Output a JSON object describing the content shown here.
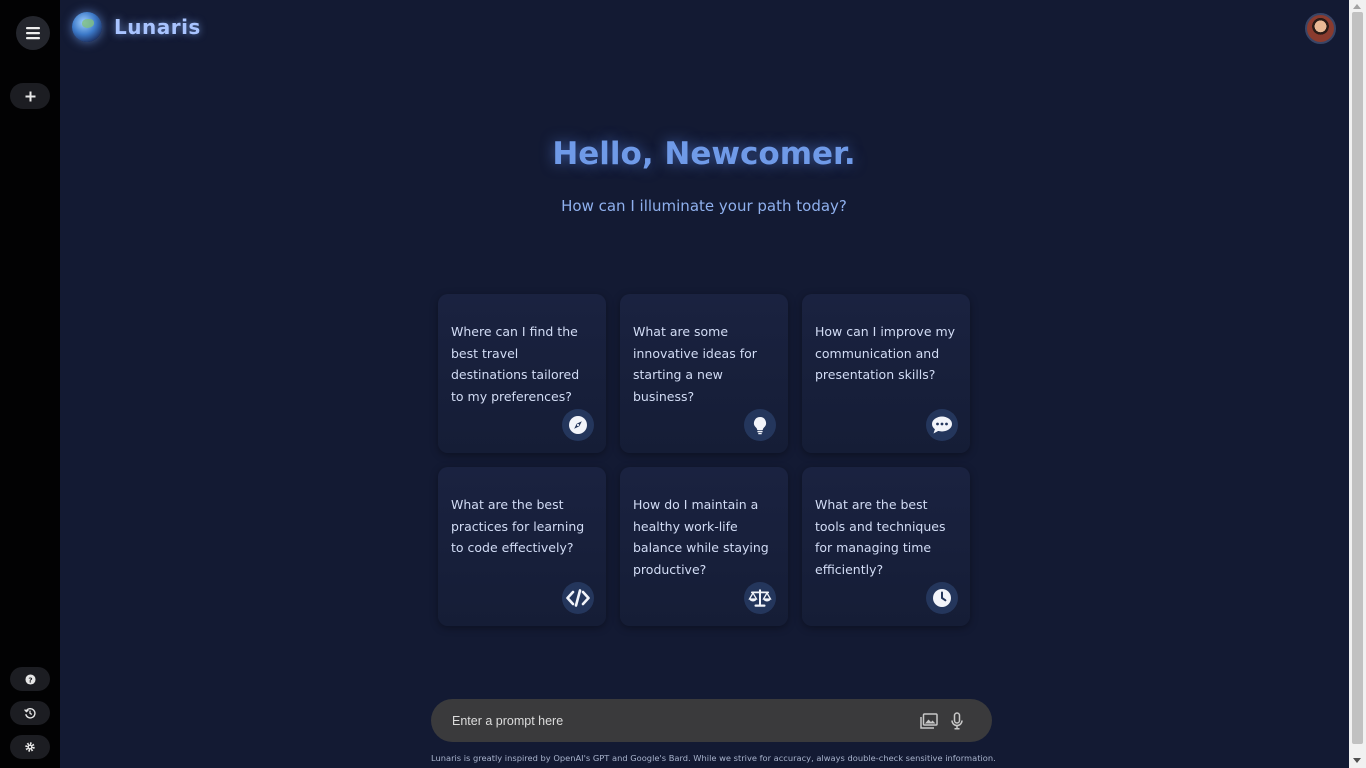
{
  "app": {
    "name": "Lunaris"
  },
  "hero": {
    "greeting": "Hello, Newcomer.",
    "subtitle": "How can I illuminate your path today?"
  },
  "suggestions": [
    {
      "text": "Where can I find the best travel destinations tailored to my preferences?",
      "icon": "compass-icon"
    },
    {
      "text": "What are some innovative ideas for starting a new business?",
      "icon": "lightbulb-icon"
    },
    {
      "text": "How can I improve my communication and presentation skills?",
      "icon": "chat-bubble-icon"
    },
    {
      "text": "What are the best practices for learning to code effectively?",
      "icon": "code-icon"
    },
    {
      "text": "How do I maintain a healthy work-life balance while staying productive?",
      "icon": "scale-icon"
    },
    {
      "text": "What are the best tools and techniques for managing time efficiently?",
      "icon": "clock-icon"
    }
  ],
  "prompt": {
    "placeholder": "Enter a prompt here",
    "value": ""
  },
  "footer": {
    "disclaimer": "Lunaris is greatly inspired by OpenAI's GPT and Google's Bard. While we strive for accuracy, always double-check sensitive information."
  },
  "colors": {
    "background": "#131a33",
    "sidebar": "#020203",
    "accent": "#6f9ae8",
    "card": "#1a2240",
    "prompt_bar": "#3a3a3c"
  }
}
